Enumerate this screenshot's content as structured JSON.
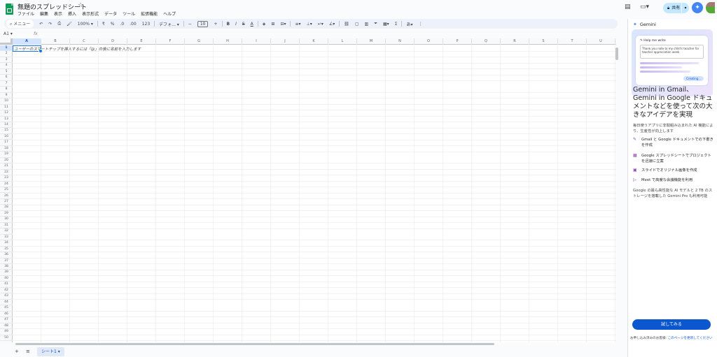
{
  "app": {
    "doc_title": "無題のスプレッドシート",
    "menu": [
      "ファイル",
      "編集",
      "表示",
      "挿入",
      "表示形式",
      "データ",
      "ツール",
      "拡張機能",
      "ヘルプ"
    ],
    "share_label": "共有"
  },
  "toolbar": {
    "search_label": "メニュー",
    "zoom": "100%",
    "currency": "₹",
    "percent": "%",
    "decrease_decimal": ".0",
    "increase_decimal": ".00",
    "number_format": "123",
    "font": "デフォ...",
    "font_size": "10",
    "bold": "B",
    "italic": "I",
    "strike": "S",
    "text_color": "A"
  },
  "formula_bar": {
    "name_box": "A1",
    "fx": "fx"
  },
  "grid": {
    "columns": [
      "A",
      "B",
      "C",
      "D",
      "E",
      "F",
      "G",
      "H",
      "I",
      "J",
      "K",
      "L",
      "M",
      "N",
      "O",
      "P",
      "Q",
      "R",
      "S",
      "T",
      "U"
    ],
    "row_count": 50,
    "selected_cell": "A1",
    "hint_text": "ユーザーのスマートチップを挿入するには「@」の後に名前を入力します"
  },
  "sheets": {
    "tabs": [
      "シート1"
    ]
  },
  "gemini_panel": {
    "title": "Gemini",
    "card_header": "Help me write",
    "card_text": "Thank you note to my child's teacher for teacher appreciation week",
    "card_button": "Creating...",
    "headline": "Gemini in Gmail、Gemini in Google ドキュメントなどを使って次の大きなアイデアを実現",
    "subtext": "毎日使うアプリに非関組み込まれた AI 機能により、生産性が向上します",
    "features": [
      "Gmail と Google ドキュメントでの下書きを作成",
      "Google スプレッドシートでプロジェクトを迅速に立案",
      "スライドでオリジナル画像を作成",
      "Meet で高度な会議機能を利用"
    ],
    "footer": "Google の最も高性能な AI モデルと 2 TB のストレージを搭載した Gemini Pro も利用可能",
    "try_button": "試してみる",
    "notice_prefix": "お申し込み済みのお客様:",
    "notice_link": "このページを更新してください"
  }
}
